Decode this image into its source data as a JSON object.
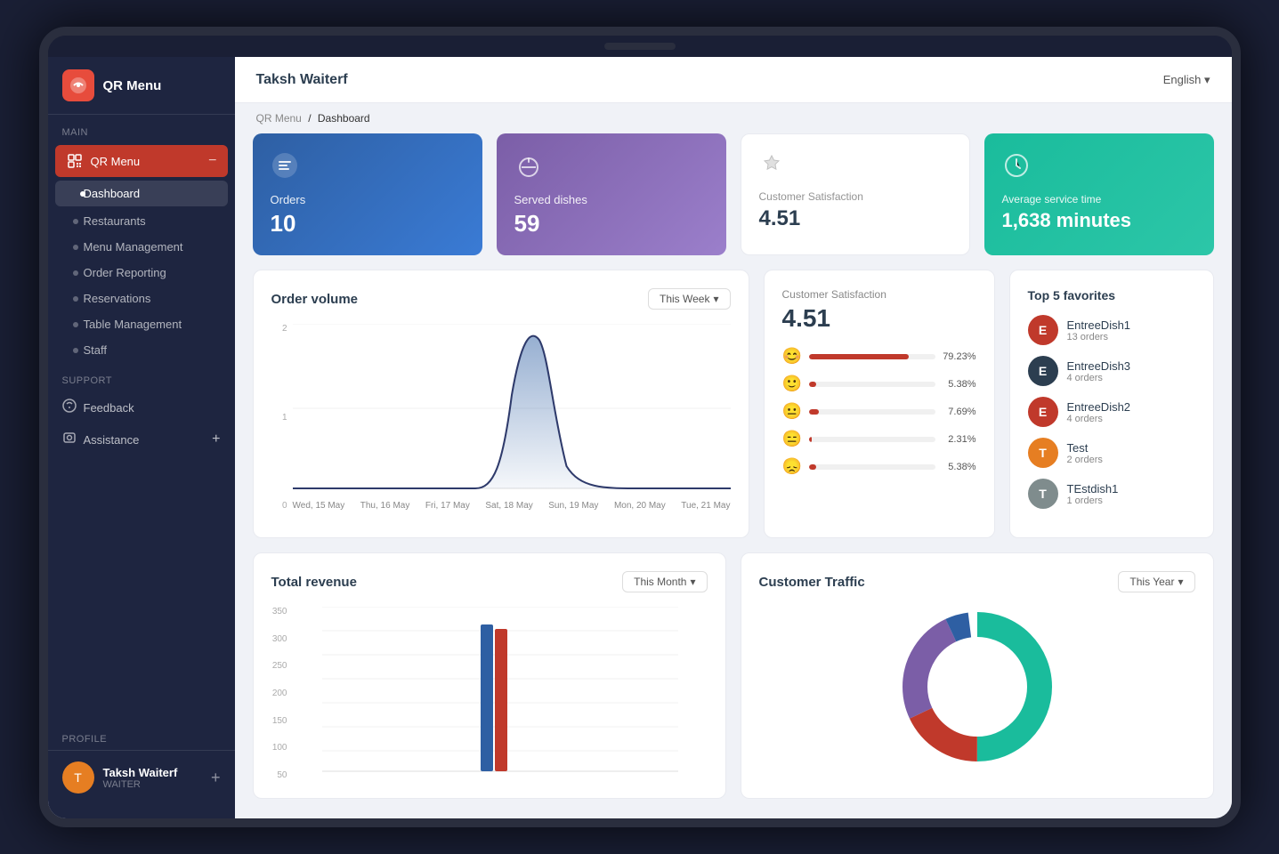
{
  "app": {
    "name": "QR Menu",
    "lang": "English"
  },
  "header": {
    "title": "Taksh Waiterf",
    "breadcrumb_home": "QR Menu",
    "breadcrumb_current": "Dashboard"
  },
  "sidebar": {
    "main_label": "Main",
    "support_label": "Support",
    "profile_label": "Profile",
    "qrmenu_item": "QR Menu",
    "nav_items": [
      {
        "label": "Dashboard",
        "active": true
      },
      {
        "label": "Restaurants"
      },
      {
        "label": "Menu Management"
      },
      {
        "label": "Order Reporting"
      },
      {
        "label": "Reservations"
      },
      {
        "label": "Table Management"
      },
      {
        "label": "Staff"
      }
    ],
    "support_items": [
      {
        "label": "Feedback"
      },
      {
        "label": "Assistance"
      }
    ],
    "profile": {
      "name": "Taksh Waiterf",
      "role": "WAITER"
    }
  },
  "stat_cards": {
    "orders": {
      "label": "Orders",
      "value": "10",
      "icon": "🍽"
    },
    "served_dishes": {
      "label": "Served dishes",
      "value": "59",
      "icon": "🥗"
    },
    "customer_satisfaction": {
      "label": "Customer Satisfaction",
      "value": "4.51",
      "icon": "👍"
    },
    "avg_service": {
      "label": "Average service time",
      "value": "1,638 minutes",
      "icon": "⏱"
    }
  },
  "order_volume": {
    "title": "Order volume",
    "filter": "This Week",
    "y_labels": [
      "2",
      "1",
      "0"
    ],
    "x_labels": [
      "Wed, 15 May",
      "Thu, 16 May",
      "Fri, 17 May",
      "Sat, 18 May",
      "Sun, 19 May",
      "Mon, 20 May",
      "Tue, 21 May"
    ]
  },
  "satisfaction": {
    "title": "Customer Satisfaction",
    "score": "4.51",
    "ratings": [
      {
        "face": "😊",
        "pct": 79.23,
        "label": "79.23%"
      },
      {
        "face": "🙂",
        "pct": 5.38,
        "label": "5.38%"
      },
      {
        "face": "😐",
        "pct": 7.69,
        "label": "7.69%"
      },
      {
        "face": "😑",
        "pct": 2.31,
        "label": "2.31%"
      },
      {
        "face": "😞",
        "pct": 5.38,
        "label": "5.38%"
      }
    ]
  },
  "top_favorites": {
    "title": "Top 5 favorites",
    "items": [
      {
        "name": "EntreeDish1",
        "orders": "13 orders",
        "color": "#c0392b"
      },
      {
        "name": "EntreeDish3",
        "orders": "4 orders",
        "color": "#2c3e50"
      },
      {
        "name": "EntreeDish2",
        "orders": "4 orders",
        "color": "#c0392b"
      },
      {
        "name": "Test",
        "orders": "2 orders",
        "color": "#e67e22"
      },
      {
        "name": "TEstdish1",
        "orders": "1 orders",
        "color": "#7f8c8d"
      }
    ]
  },
  "total_revenue": {
    "title": "Total revenue",
    "filter": "This Month",
    "y_labels": [
      "350",
      "300",
      "250",
      "200",
      "150",
      "100",
      "50"
    ]
  },
  "customer_traffic": {
    "title": "Customer Traffic",
    "filter": "This Year",
    "segments": [
      {
        "color": "#1abc9c",
        "pct": 55
      },
      {
        "color": "#c0392b",
        "pct": 20
      },
      {
        "color": "#7b5ea7",
        "pct": 20
      },
      {
        "color": "#2e5fa3",
        "pct": 5
      }
    ]
  }
}
